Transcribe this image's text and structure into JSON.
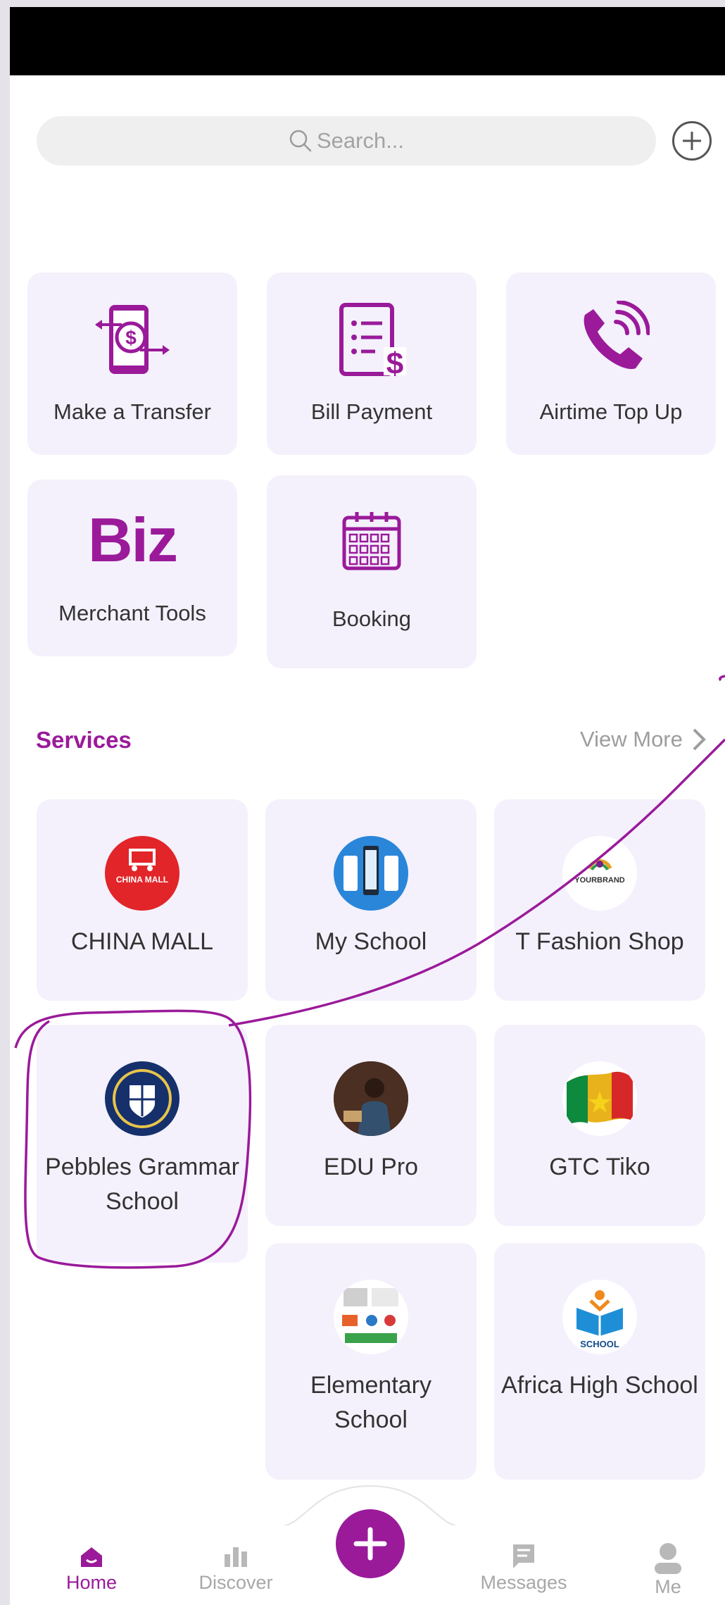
{
  "search": {
    "placeholder": "Search..."
  },
  "quick_actions": [
    {
      "label": "Make a Transfer",
      "icon": "transfer-icon"
    },
    {
      "label": "Bill Payment",
      "icon": "bill-icon"
    },
    {
      "label": "Airtime Top Up",
      "icon": "phone-icon"
    },
    {
      "label": "Merchant Tools",
      "icon": "biz-logo",
      "logo_text": "Biz"
    },
    {
      "label": "Booking",
      "icon": "calendar-icon"
    }
  ],
  "services": {
    "title": "Services",
    "view_more": "View More",
    "items": [
      {
        "label": "CHINA MALL",
        "logo": "china-mall-logo",
        "logo_text": "CHINA MALL"
      },
      {
        "label": "My School",
        "logo": "my-school-logo"
      },
      {
        "label": "T Fashion Shop",
        "logo": "yourbrand-logo",
        "logo_text": "YOURBRAND"
      },
      {
        "label": "Pebbles Grammar School",
        "logo": "pebbles-crest-logo"
      },
      {
        "label": "EDU Pro",
        "logo": "edu-pro-photo"
      },
      {
        "label": "GTC Tiko",
        "logo": "cameroon-flag-logo"
      },
      {
        "label": "Elementary School",
        "logo": "elementary-collage-logo"
      },
      {
        "label": "Africa High School",
        "logo": "school-book-logo",
        "logo_text": "SCHOOL"
      }
    ]
  },
  "nav": {
    "home": "Home",
    "discover": "Discover",
    "messages": "Messages",
    "me": "Me"
  },
  "colors": {
    "accent": "#9a1a9a",
    "card": "#f4f1fc"
  }
}
